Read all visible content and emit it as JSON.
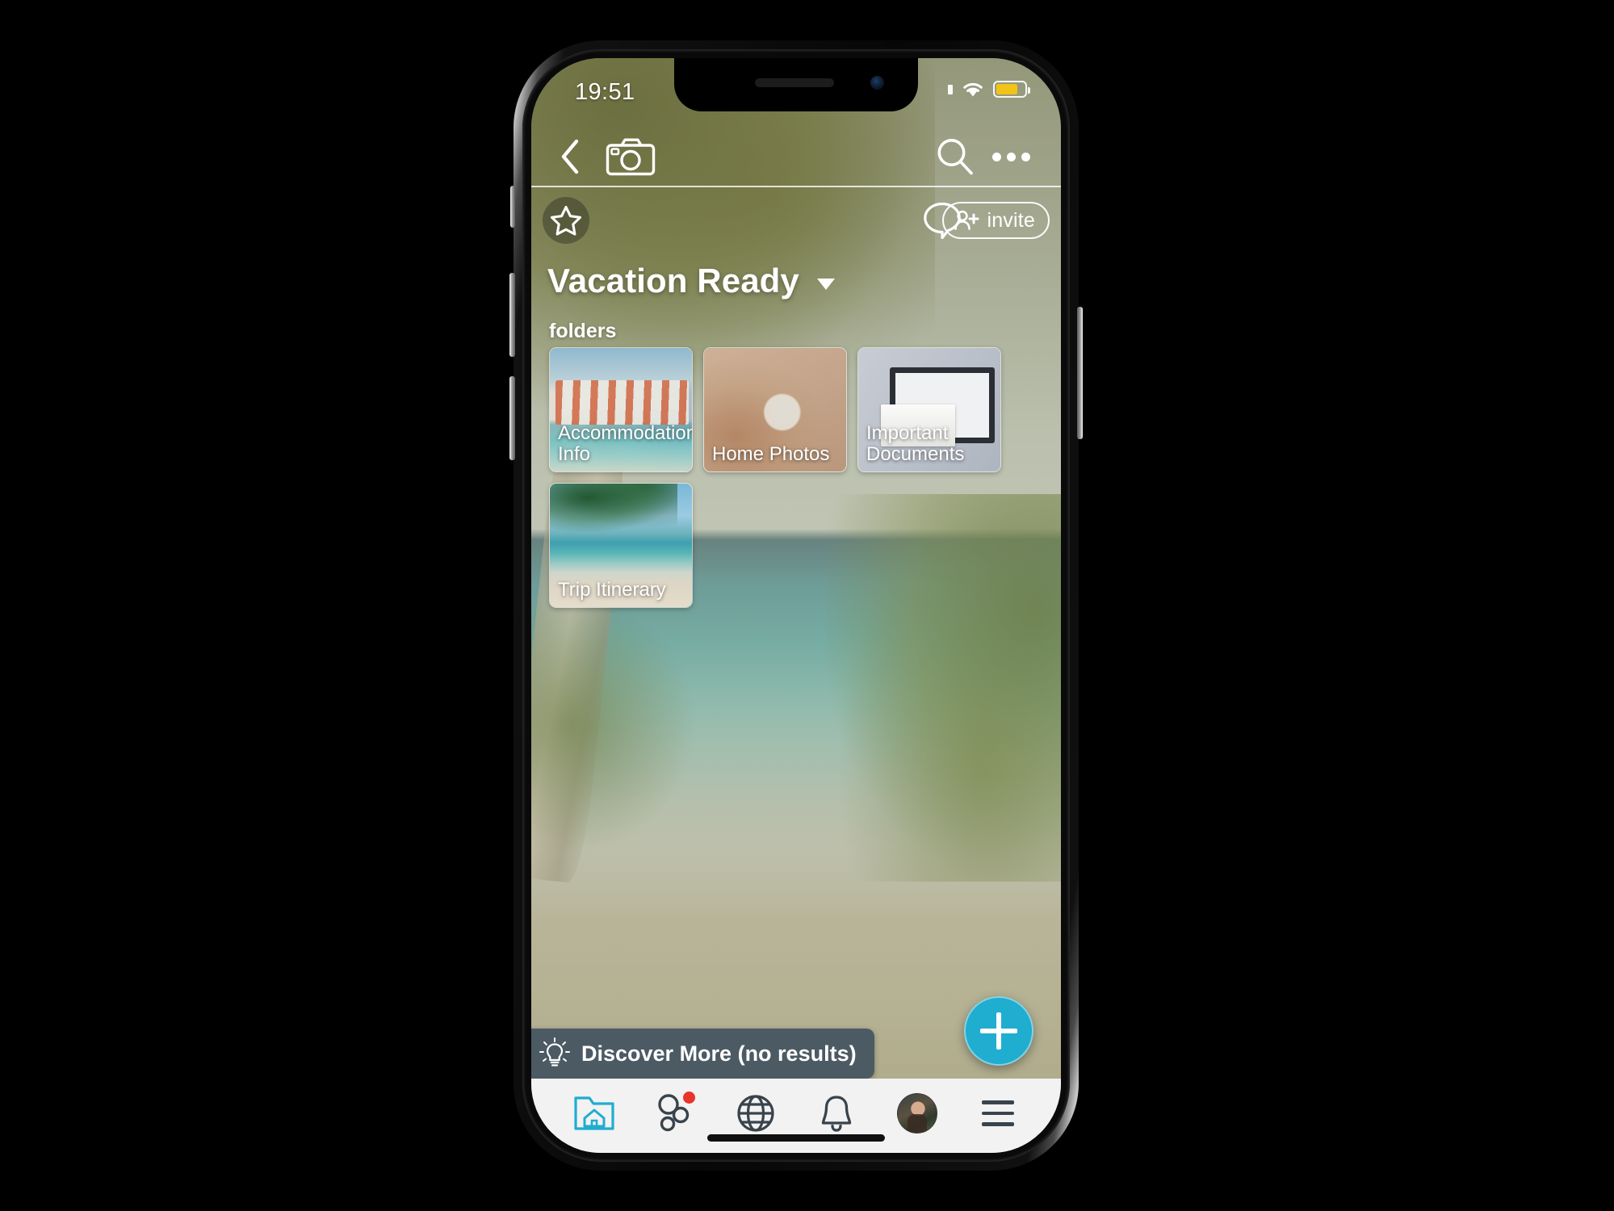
{
  "status_bar": {
    "time": "19:51",
    "wifi_icon": "wifi-icon",
    "battery_icon": "battery-low-power-icon",
    "location_icon": "location-indicator-icon"
  },
  "nav_bar": {
    "back_icon": "back-chevron-icon",
    "camera_icon": "camera-icon",
    "search_icon": "search-icon",
    "more_icon": "overflow-menu-icon"
  },
  "sub_bar": {
    "favorite_icon": "star-icon",
    "chat_icon": "chat-bubble-icon",
    "invite_label": "invite",
    "invite_icon": "add-person-icon"
  },
  "header": {
    "title": "Vacation Ready",
    "caret_icon": "chevron-down-icon"
  },
  "content": {
    "section_label": "folders",
    "folders": [
      {
        "name": "Accommodation Info",
        "thumb": "resort-by-the-sea-photo"
      },
      {
        "name": "Home Photos",
        "thumb": "hand-on-thermostat-photo"
      },
      {
        "name": "Important Documents",
        "thumb": "monitor-and-magnifier-photo"
      },
      {
        "name": "Trip Itinerary",
        "thumb": "palm-trees-beach-photo"
      }
    ]
  },
  "discover": {
    "label": "Discover More (no results)",
    "icon": "lightbulb-idea-icon"
  },
  "fab": {
    "icon": "plus-icon",
    "color": "#1fadd0"
  },
  "tab_bar": {
    "items": [
      {
        "name": "home-folder",
        "icon": "folder-home-icon",
        "active": true,
        "badge": false
      },
      {
        "name": "groups",
        "icon": "groups-bubbles-icon",
        "active": false,
        "badge": true
      },
      {
        "name": "discover",
        "icon": "globe-icon",
        "active": false,
        "badge": false
      },
      {
        "name": "alerts",
        "icon": "bell-icon",
        "active": false,
        "badge": false
      },
      {
        "name": "profile",
        "icon": "avatar-icon",
        "active": false,
        "badge": false
      },
      {
        "name": "menu",
        "icon": "hamburger-menu-icon",
        "active": false,
        "badge": false
      }
    ],
    "active_color": "#1fadd0",
    "badge_color": "#e8342a"
  }
}
